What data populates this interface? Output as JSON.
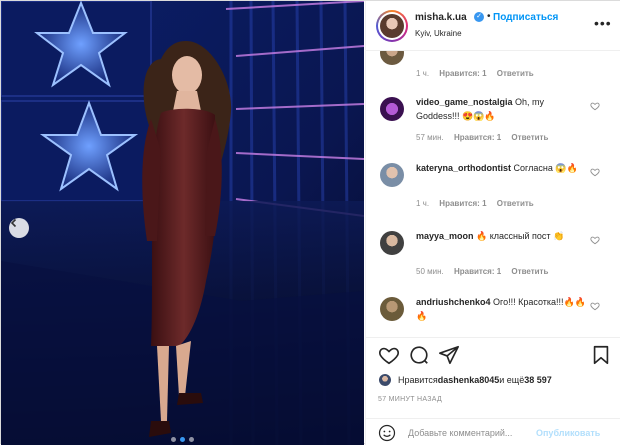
{
  "header": {
    "username": "misha.k.ua",
    "verified_mark": "✓",
    "separator": "•",
    "follow_label": "Подписаться",
    "location": "Kyiv, Ukraine",
    "more_icon": "more-horizontal-icon"
  },
  "comments": [
    {
      "username": "",
      "text": "",
      "time": "1 ч.",
      "likes": "Нравится: 1",
      "reply": "Ответить"
    },
    {
      "username": "video_game_nostalgia",
      "text": " Oh, my Goddess!!! 😍😱🔥",
      "time": "57 мин.",
      "likes": "Нравится: 1",
      "reply": "Ответить"
    },
    {
      "username": "kateryna_orthodontist",
      "text": " Согласна 😱🔥",
      "time": "1 ч.",
      "likes": "Нравится: 1",
      "reply": "Ответить"
    },
    {
      "username": "mayya_moon",
      "text": " 🔥 классный пост 👏",
      "time": "50 мин.",
      "likes": "Нравится: 1",
      "reply": "Ответить"
    },
    {
      "username": "andriushchenko4",
      "text": " Ого!!! Красотка!!!🔥🔥🔥",
      "time": "",
      "likes": "",
      "reply": ""
    }
  ],
  "likes": {
    "prefix": "Нравится ",
    "user": "dashenka8045",
    "middle": " и ещё ",
    "count": "38 597"
  },
  "time_ago": "57 МИНУТ НАЗАД",
  "add_comment": {
    "placeholder": "Добавьте комментарий...",
    "publish_label": "Опубликовать"
  },
  "carousel": {
    "slide_count": 3,
    "active_index": 1
  },
  "colors": {
    "accent": "#0095f6",
    "publish_disabled": "#b2dffc",
    "meta_gray": "#8e8e8e",
    "background_blue": "#0a1a55"
  }
}
